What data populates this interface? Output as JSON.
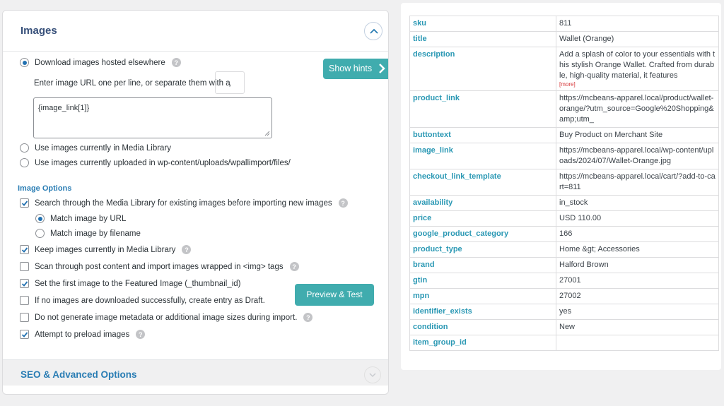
{
  "images_panel": {
    "title": "Images",
    "download_option": "Download images hosted elsewhere",
    "separator_prompt": "Enter image URL one per line, or separate them with a",
    "separator_value": ",",
    "image_field_value": "{image_link[1]}",
    "media_library_option": "Use images currently in Media Library",
    "uploaded_option": "Use images currently uploaded in wp-content/uploads/wpallimport/files/",
    "options_heading": "Image Options",
    "search_media": "Search through the Media Library for existing images before importing new images",
    "match_url": "Match image by URL",
    "match_filename": "Match image by filename",
    "keep_images": "Keep images currently in Media Library",
    "scan_content": "Scan through post content and import images wrapped in <img> tags",
    "featured_image": "Set the first image to the Featured Image (_thumbnail_id)",
    "draft_option": "If no images are downloaded successfully, create entry as Draft.",
    "no_metadata": "Do not generate image metadata or additional image sizes during import.",
    "preload": "Attempt to preload images",
    "help_glyph": "?"
  },
  "buttons": {
    "show_hints": "Show hints",
    "preview_test": "Preview & Test"
  },
  "seo_section": {
    "title": "SEO & Advanced Options"
  },
  "product_table": {
    "rows": [
      {
        "key": "sku",
        "value": "811"
      },
      {
        "key": "title",
        "value": "Wallet (Orange)"
      },
      {
        "key": "description",
        "value": "Add a splash of color to your essentials with this stylish Orange Wallet. Crafted from durable, high-quality material, it features",
        "more": "[more]"
      },
      {
        "key": "product_link",
        "value": "https://mcbeans-apparel.local/product/wallet-orange/?utm_source=Google%20Shopping&amp;utm_"
      },
      {
        "key": "buttontext",
        "value": "Buy Product on Merchant Site"
      },
      {
        "key": "image_link",
        "value": "https://mcbeans-apparel.local/wp-content/uploads/2024/07/Wallet-Orange.jpg"
      },
      {
        "key": "checkout_link_template",
        "value": "https://mcbeans-apparel.local/cart/?add-to-cart=811"
      },
      {
        "key": "availability",
        "value": "in_stock"
      },
      {
        "key": "price",
        "value": "USD 110.00"
      },
      {
        "key": "google_product_category",
        "value": "166"
      },
      {
        "key": "product_type",
        "value": "Home &gt; Accessories"
      },
      {
        "key": "brand",
        "value": "Halford Brown"
      },
      {
        "key": "gtin",
        "value": "27001"
      },
      {
        "key": "mpn",
        "value": "27002"
      },
      {
        "key": "identifier_exists",
        "value": "yes"
      },
      {
        "key": "condition",
        "value": "New"
      },
      {
        "key": "item_group_id",
        "value": ""
      }
    ]
  },
  "colors": {
    "accent": "#40acae",
    "link": "#2a7db4",
    "key_text": "#2a98b4",
    "title": "#37507a"
  }
}
